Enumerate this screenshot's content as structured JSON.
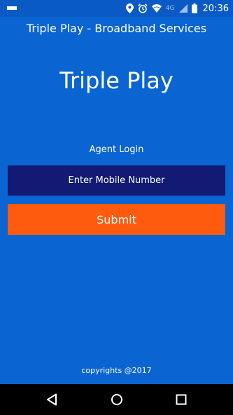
{
  "status_bar": {
    "time": "20:36",
    "network_label": "4G",
    "icons": [
      "notification-icon",
      "location-icon",
      "alarm-icon",
      "wifi-icon",
      "cell-signal-icon",
      "battery-icon"
    ]
  },
  "app_bar": {
    "title": "Triple Play - Broadband Services"
  },
  "main": {
    "hero_title": "Triple Play",
    "section_label": "Agent Login",
    "mobile_input": {
      "placeholder": "Enter Mobile Number",
      "value": ""
    },
    "submit_label": "Submit"
  },
  "footer": {
    "copyright": "copyrights @2017"
  },
  "nav_bar": {
    "icons": [
      "back-icon",
      "home-icon",
      "recents-icon"
    ]
  },
  "colors": {
    "background": "#0a64d2",
    "input_background": "#121a74",
    "submit_background": "#ff5b0f",
    "nav_background": "#000000"
  }
}
